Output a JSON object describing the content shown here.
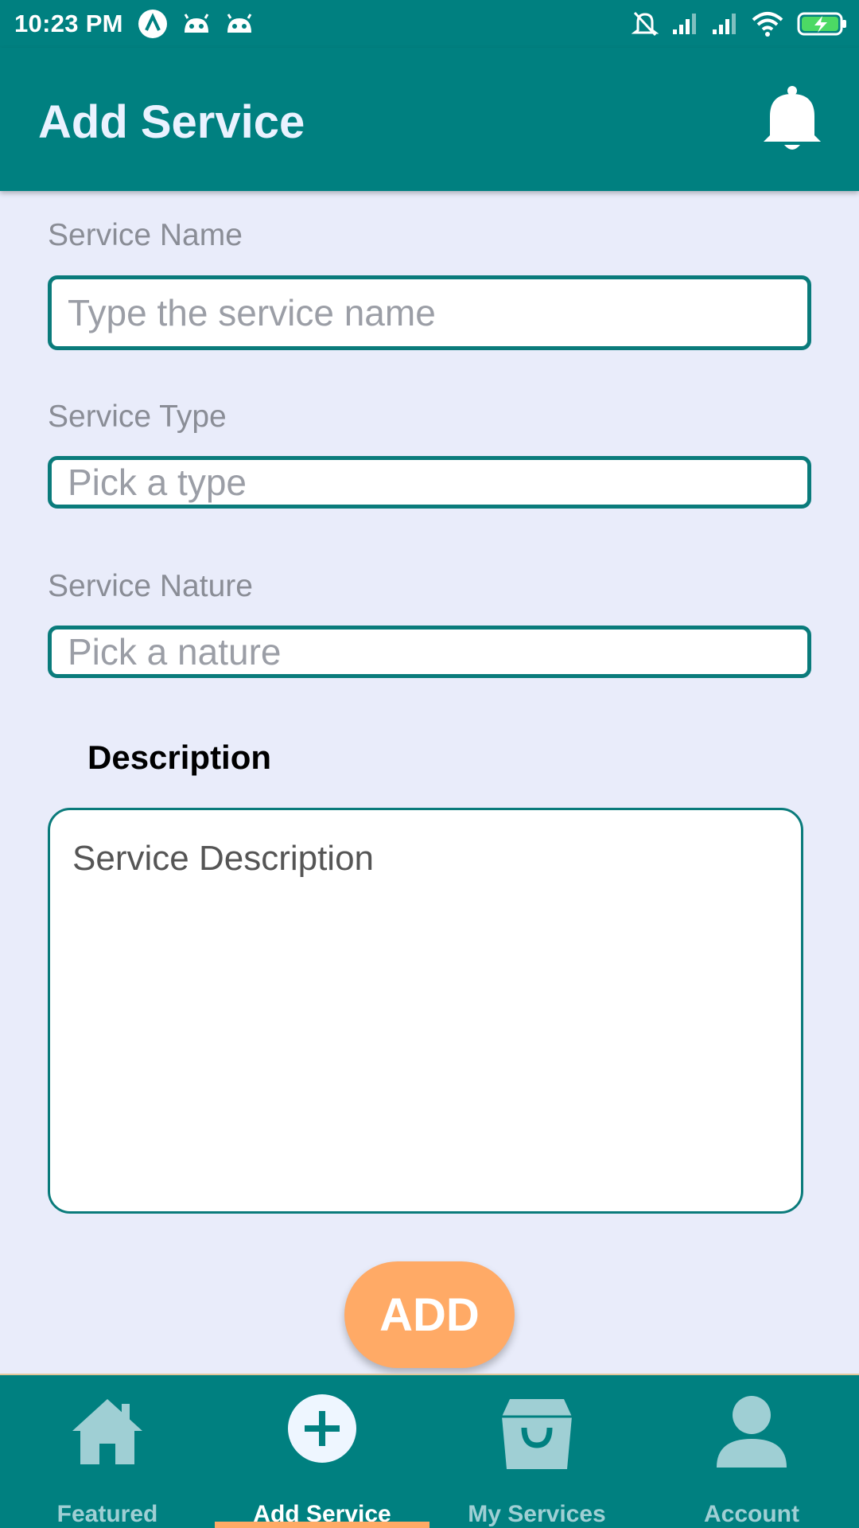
{
  "status_bar": {
    "time": "10:23 PM"
  },
  "app_bar": {
    "title": "Add Service"
  },
  "form": {
    "service_name": {
      "label": "Service Name",
      "placeholder": "Type the service name"
    },
    "service_type": {
      "label": "Service Type",
      "placeholder": "Pick a type"
    },
    "service_nature": {
      "label": "Service Nature",
      "placeholder": "Pick a nature"
    },
    "description": {
      "label": "Description",
      "placeholder": "Service Description"
    },
    "submit_label": "ADD"
  },
  "bottom_nav": {
    "items": [
      {
        "label": "Featured",
        "icon": "home-icon"
      },
      {
        "label": "Add Service",
        "icon": "add-circle-icon",
        "active": true
      },
      {
        "label": "My Services",
        "icon": "shopping-bag-icon"
      },
      {
        "label": "Account",
        "icon": "person-icon"
      }
    ]
  },
  "colors": {
    "primary": "#008080",
    "accent": "#ffaa66",
    "background": "#e9ecfa"
  }
}
